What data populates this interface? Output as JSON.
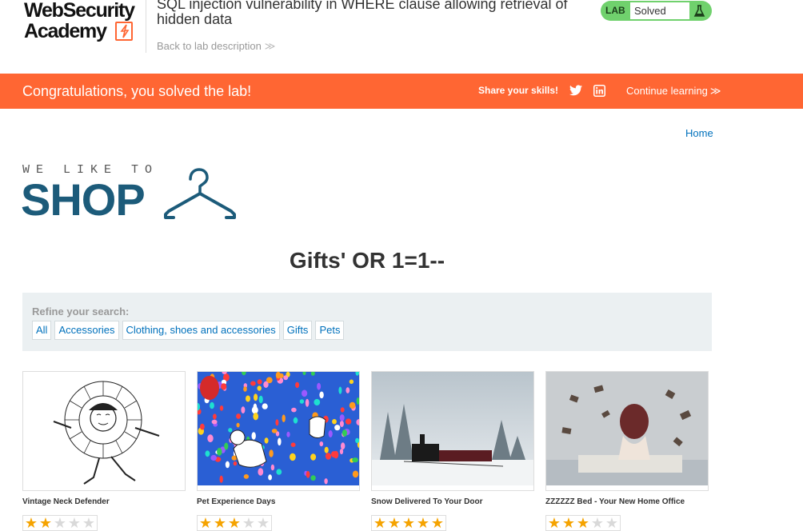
{
  "academy": {
    "logo_line1": "WebSecurity",
    "logo_line2": "Academy",
    "lab_title": "SQL injection vulnerability in WHERE clause allowing retrieval of hidden data",
    "back_link": "Back to lab description",
    "back_chevron": "≫",
    "status_label": "LAB",
    "status_value": "Solved"
  },
  "banner": {
    "congrats": "Congratulations, you solved the lab!",
    "share": "Share your skills!",
    "continue": "Continue learning",
    "continue_chevron": "≫",
    "icons": [
      "twitter-icon",
      "linkedin-icon"
    ]
  },
  "nav": {
    "home": "Home"
  },
  "shop_logo": {
    "tagline": "WE LIKE TO",
    "word": "SHOP"
  },
  "search": {
    "heading": "Gifts' OR 1=1--"
  },
  "refine": {
    "label": "Refine your search:",
    "filters": [
      "All",
      "Accessories",
      "Clothing, shoes and accessories",
      "Gifts",
      "Pets"
    ]
  },
  "products": [
    {
      "name": "Vintage Neck Defender",
      "rating": 2
    },
    {
      "name": "Pet Experience Days",
      "rating": 3
    },
    {
      "name": "Snow Delivered To Your Door",
      "rating": 5
    },
    {
      "name": "ZZZZZZ Bed - Your New Home Office",
      "rating": 3
    }
  ],
  "colors": {
    "brand_orange": "#ff6633",
    "status_green": "#70d16d",
    "link_blue": "#0071bc",
    "shop_teal": "#1c5b7a",
    "star": "#f5a300"
  }
}
